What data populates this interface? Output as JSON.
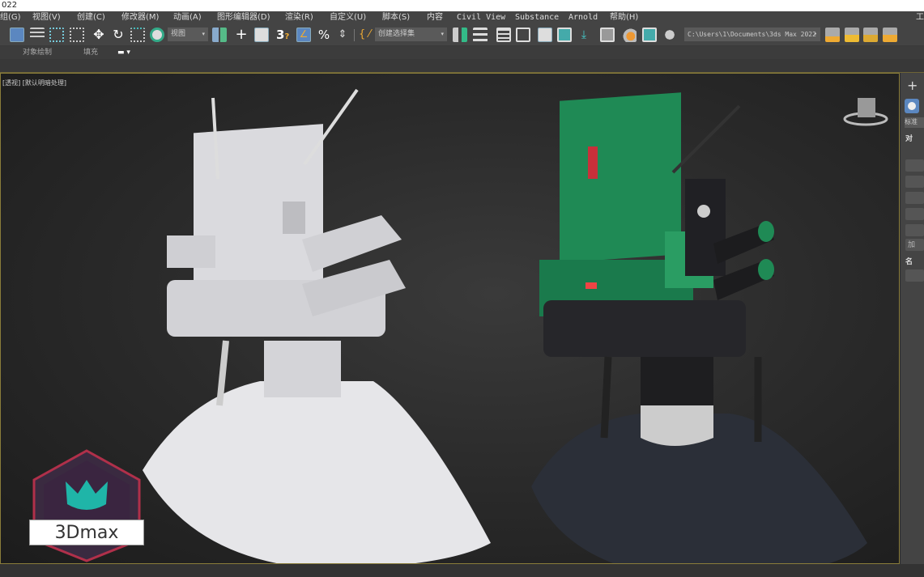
{
  "title": "022",
  "menu": [
    "组(G)",
    "视图(V)",
    "创建(C)",
    "修改器(M)",
    "动画(A)",
    "图形编辑器(D)",
    "渲染(R)",
    "自定义(U)",
    "脚本(S)",
    "内容",
    "Civil View",
    "Substance",
    "Arnold",
    "帮助(H)"
  ],
  "menu_right": "工",
  "toolbar": {
    "view_dropdown": "视图",
    "selection_set": "创建选择集",
    "project_path": "C:\\Users\\1\\Documents\\3ds Max 2022",
    "snap_label": "3"
  },
  "ribbon": {
    "object_paint": "对象绘制",
    "fill": "填充"
  },
  "viewport": {
    "label": "[透视] [默认明暗处理]"
  },
  "panel": {
    "plus": "+",
    "dropdown": "标准",
    "section1": "对",
    "btn": "加",
    "section2": "名"
  },
  "logo": {
    "text": "3Dmax"
  },
  "colors": {
    "accent": "#5b87c0",
    "robot_green": "#1f8a55"
  }
}
